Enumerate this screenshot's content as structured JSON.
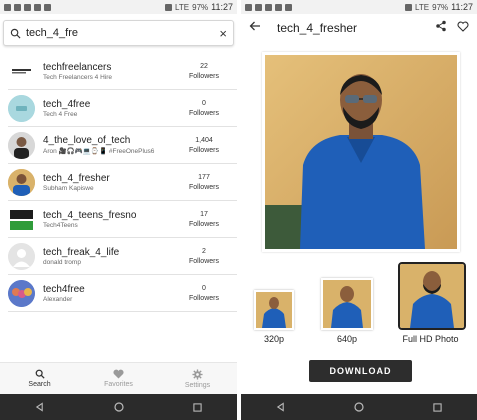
{
  "status_bar": {
    "time": "11:27",
    "battery": "97%",
    "network": "LTE"
  },
  "left_screen": {
    "search": {
      "value": "tech_4_fre",
      "clear_symbol": "×"
    },
    "results": [
      {
        "name": "techfreelancers",
        "subtitle": "Tech Freelancers 4 Hire",
        "count": "22",
        "count_label": "Followers",
        "avatar_text": "TechFreelancers"
      },
      {
        "name": "tech_4free",
        "subtitle": "Tech 4 Free",
        "count": "0",
        "count_label": "Followers",
        "avatar_text": ""
      },
      {
        "name": "4_the_love_of_tech",
        "subtitle": "Aron 🎥🎧🎮💻⌚📱 #FreeOnePlus6",
        "count": "1,404",
        "count_label": "Followers",
        "avatar_text": ""
      },
      {
        "name": "tech_4_fresher",
        "subtitle": "Subham Kapiswe",
        "count": "177",
        "count_label": "Followers",
        "avatar_text": ""
      },
      {
        "name": "tech_4_teens_fresno",
        "subtitle": "Tech4Teens",
        "count": "17",
        "count_label": "Followers",
        "avatar_text": "Tech 4 Teens"
      },
      {
        "name": "tech_freak_4_life",
        "subtitle": "donald tromp",
        "count": "2",
        "count_label": "Followers",
        "avatar_text": ""
      },
      {
        "name": "tech4free",
        "subtitle": "Alexander",
        "count": "0",
        "count_label": "Followers",
        "avatar_text": ""
      }
    ],
    "bottom_nav": [
      {
        "label": "Search",
        "icon": "search-icon",
        "active": true
      },
      {
        "label": "Favorites",
        "icon": "heart-icon",
        "active": false
      },
      {
        "label": "Settings",
        "icon": "gear-icon",
        "active": false
      }
    ]
  },
  "right_screen": {
    "title": "tech_4_fresher",
    "thumbnails": [
      {
        "label": "320p"
      },
      {
        "label": "640p"
      },
      {
        "label": "Full HD Photo"
      }
    ],
    "download_label": "DOWNLOAD"
  },
  "colors": {
    "accent_dark": "#2d2d2d",
    "shirt_blue": "#1f5fb8",
    "wall_yellow": "#d9b26a"
  }
}
